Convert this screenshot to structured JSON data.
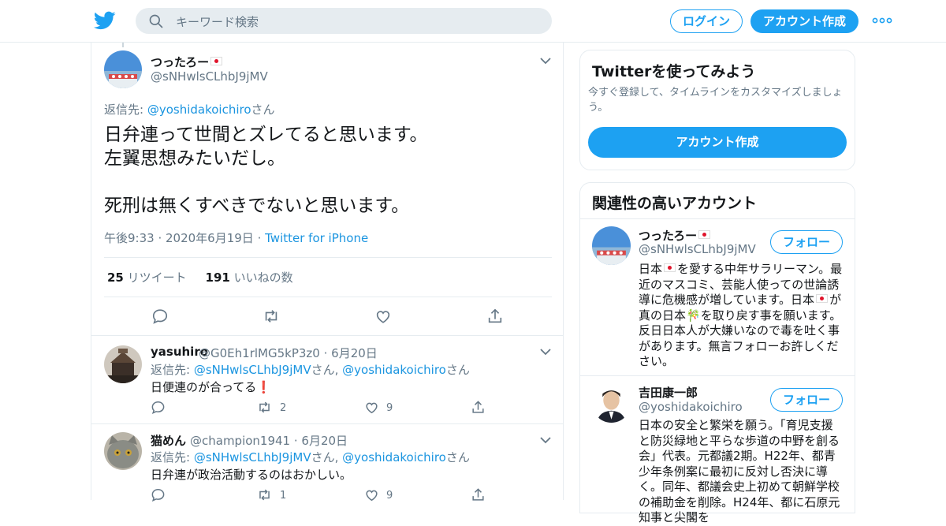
{
  "header": {
    "search_placeholder": "キーワード検索",
    "login_label": "ログイン",
    "signup_label": "アカウント作成"
  },
  "main_tweet": {
    "name": "つったろー",
    "handle": "@sNHwlsCLhbJ9jMV",
    "reply_prefix": "返信先: ",
    "reply_to": "@yoshidakoichiro",
    "reply_suffix": "さん",
    "text_line1": "日弁連って世間とズレてると思います。",
    "text_line2": "左翼思想みたいだし。",
    "text_line3": "死刑は無くすべきでないと思います。",
    "time": "午後9:33",
    "date": "2020年6月19日",
    "source": "Twitter for iPhone",
    "retweets": "25",
    "retweets_label": "リツイート",
    "likes": "191",
    "likes_label": "いいねの数"
  },
  "replies": [
    {
      "name": "yasuhiro",
      "handle": "@G0Eh1rlMG5kP3z0",
      "date": "6月20日",
      "reply_prefix": "返信先: ",
      "reply_to_1": "@sNHwlsCLhbJ9jMV",
      "mid": "さん, ",
      "reply_to_2": "@yoshidakoichiro",
      "suffix": "さん",
      "text": "日便連のが合ってる",
      "retweets": "2",
      "likes": "9"
    },
    {
      "name": "猫めん",
      "handle": "@champion1941",
      "date": "6月20日",
      "reply_prefix": "返信先: ",
      "reply_to_1": "@sNHwlsCLhbJ9jMV",
      "mid": "さん, ",
      "reply_to_2": "@yoshidakoichiro",
      "suffix": "さん",
      "text": "日弁連が政治活動するのはおかしい。",
      "retweets": "1",
      "likes": "9"
    }
  ],
  "signup_card": {
    "title": "Twitterを使ってみよう",
    "subtitle": "今すぐ登録して、タイムラインをカスタマイズしましょう。",
    "button": "アカウント作成"
  },
  "related": {
    "title": "関連性の高いアカウント",
    "follow_label": "フォロー",
    "accounts": [
      {
        "name": "つったろー",
        "handle": "@sNHwlsCLhbJ9jMV",
        "bio_a": "日本",
        "bio_b": "を愛する中年サラリーマン。最近のマスコミ、芸能人使っての世論誘導に危機感が増しています。日本",
        "bio_c": "が真の日本",
        "bio_d": "を取り戻す事を願います。反日日本人が大嫌いなので毒を吐く事があります。無言フォローお許しください。"
      },
      {
        "name": "吉田康一郎",
        "handle": "@yoshidakoichiro",
        "bio": "日本の安全と繁栄を願う。「育児支援と防災緑地と平らな歩道の中野を創る会」代表。元都議2期。H22年、都青少年条例案に最初に反対し否決に導く。同年、都議会史上初めて朝鮮学校の補助金を削除。H24年、都に石原元知事と尖閣を"
      }
    ]
  },
  "colors": {
    "accent": "#1da1f2",
    "link": "#1b95e0",
    "muted": "#657786",
    "flag_red": "#e0142b"
  }
}
